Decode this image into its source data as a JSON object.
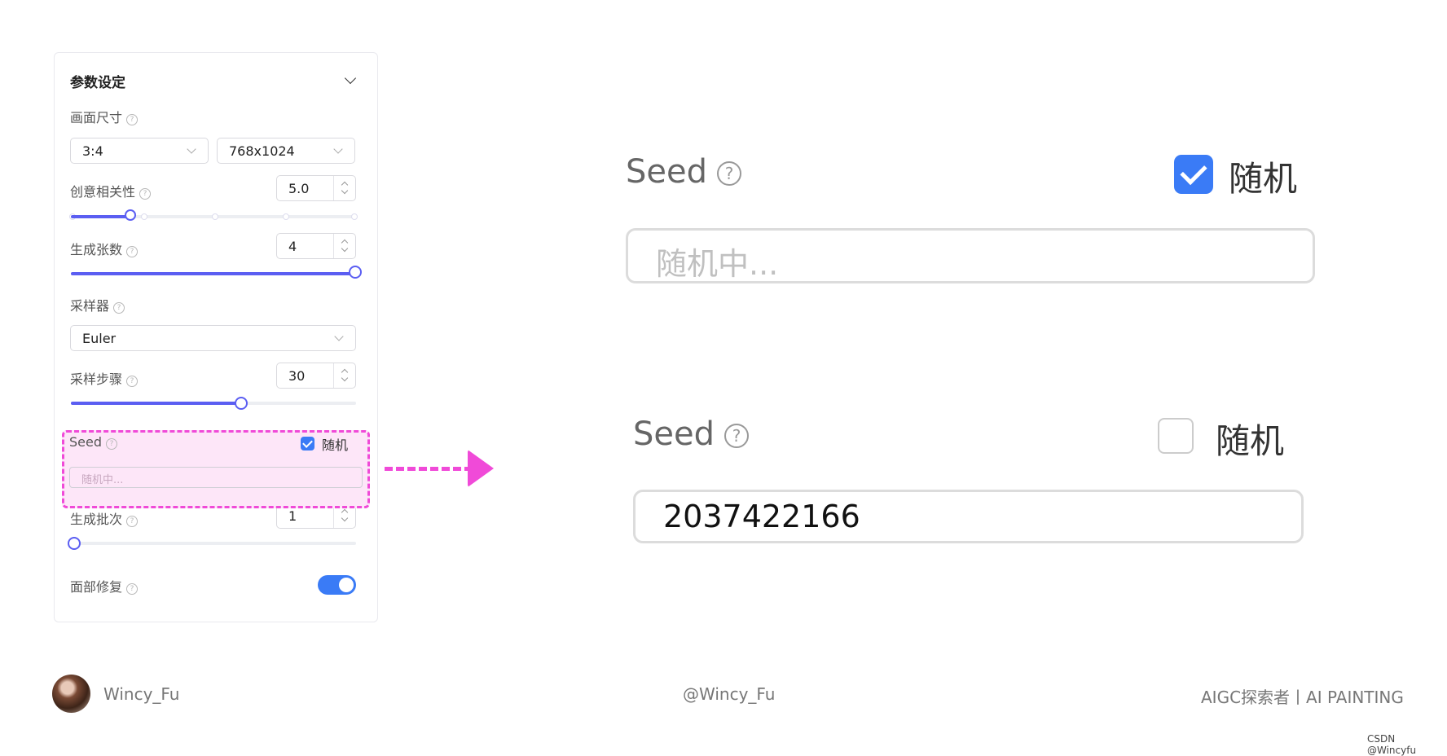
{
  "panel": {
    "title": "参数设定",
    "canvas_size": {
      "label": "画面尺寸",
      "ratio_value": "3:4",
      "resolution_value": "768x1024"
    },
    "creativity": {
      "label": "创意相关性",
      "value": "5.0",
      "slider_fraction": 0.2
    },
    "count": {
      "label": "生成张数",
      "value": "4",
      "slider_fraction": 1.0
    },
    "sampler": {
      "label": "采样器",
      "value": "Euler"
    },
    "steps": {
      "label": "采样步骤",
      "value": "30",
      "slider_fraction": 0.6
    },
    "seed": {
      "label": "Seed",
      "random_label": "随机",
      "random_checked": true,
      "placeholder": "随机中..."
    },
    "batch": {
      "label": "生成批次",
      "value": "1",
      "slider_fraction": 0.0
    },
    "face_fix": {
      "label": "面部修复",
      "enabled": true
    }
  },
  "help_glyph": "?",
  "zoom_checked": {
    "label": "Seed",
    "random_label": "随机",
    "checked": true,
    "placeholder": "随机中..."
  },
  "zoom_unchecked": {
    "label": "Seed",
    "random_label": "随机",
    "checked": false,
    "value": "2037422166"
  },
  "footer": {
    "author": "Wincy_Fu",
    "handle": "@Wincy_Fu",
    "tagline": "AIGC探索者丨AI PAINTING",
    "watermark": "CSDN @Wincyfu"
  },
  "colors": {
    "accent": "#5b5ef2",
    "checkbox": "#3a7bf6",
    "highlight": "#f04ad8"
  }
}
